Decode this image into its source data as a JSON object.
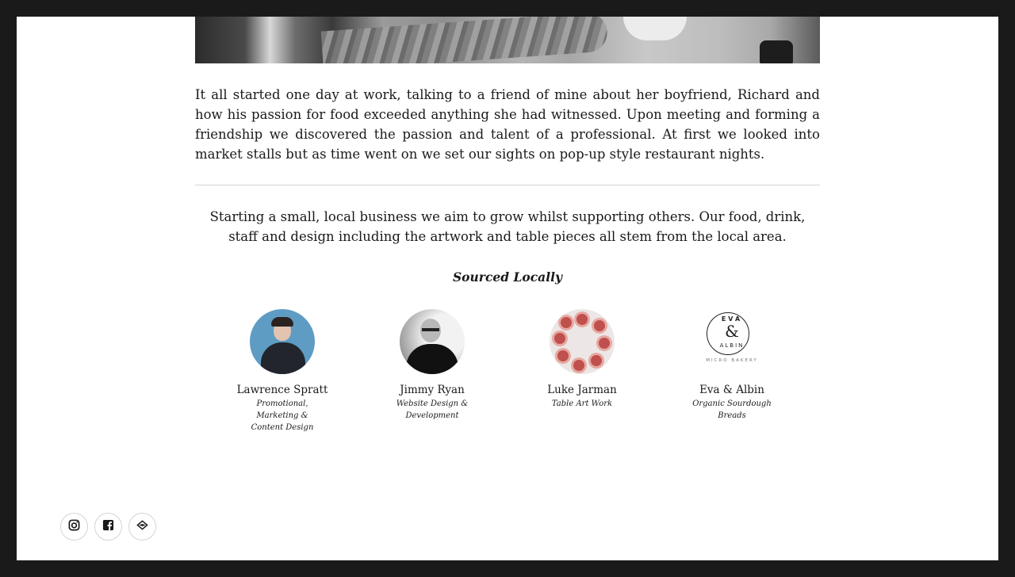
{
  "intro": {
    "paragraph": "It all started one day at work, talking to a friend of mine about her boyfriend, Richard and how his passion for food exceeded anything she had witnessed. Upon meeting and forming a friendship we discovered the passion and talent of a professional. At first we looked into market stalls but as time went on we set our sights on pop-up style restaurant nights."
  },
  "mission": {
    "text": "Starting a small, local business we aim to grow whilst supporting others. Our food, drink, staff and design including the artwork and table pieces all stem from the local area."
  },
  "sourced": {
    "heading": "Sourced Locally",
    "people": [
      {
        "name": "Lawrence Spratt",
        "role": "Promotional, Marketing & Content Design"
      },
      {
        "name": "Jimmy Ryan",
        "role": "Website Design & Development"
      },
      {
        "name": "Luke Jarman",
        "role": "Table Art Work"
      },
      {
        "name": "Eva & Albin",
        "role": "Organic Sourdough Breads"
      }
    ],
    "eva_logo": {
      "top": "EVA",
      "amp": "&",
      "bottom": "ALBIN",
      "sub": "MICRO BAKERY"
    }
  },
  "social": {
    "items": [
      {
        "icon": "instagram-icon"
      },
      {
        "icon": "facebook-icon"
      },
      {
        "icon": "tripadvisor-icon"
      }
    ]
  }
}
